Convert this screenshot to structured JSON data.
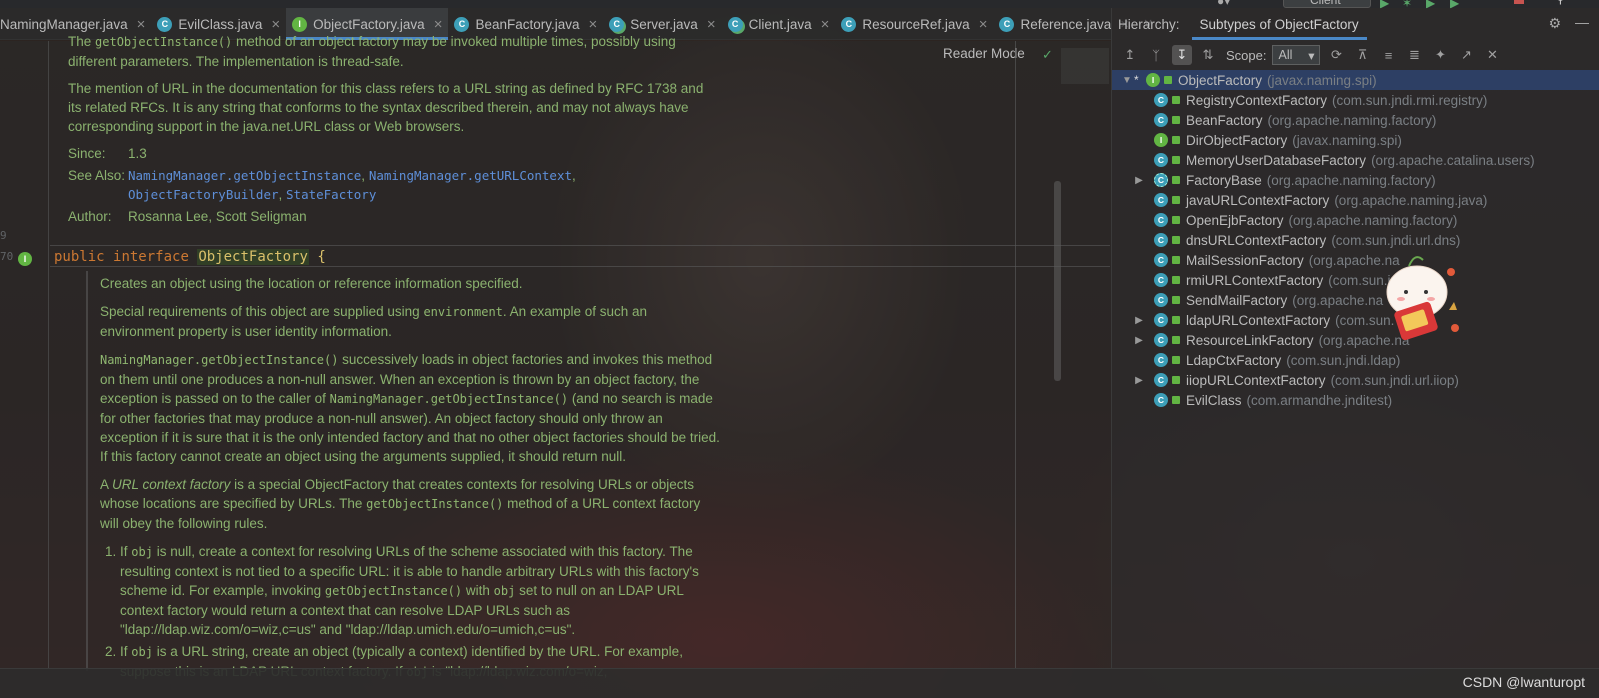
{
  "topbar": {
    "run_config": "Client"
  },
  "tabs": [
    {
      "label": "NamingManager.java",
      "icon": "class",
      "active": false
    },
    {
      "label": "EvilClass.java",
      "icon": "class",
      "active": false
    },
    {
      "label": "ObjectFactory.java",
      "icon": "interface",
      "active": true
    },
    {
      "label": "BeanFactory.java",
      "icon": "class",
      "active": false
    },
    {
      "label": "Server.java",
      "icon": "main-class",
      "active": false
    },
    {
      "label": "Client.java",
      "icon": "main-class",
      "active": false
    },
    {
      "label": "ResourceRef.java",
      "icon": "class",
      "active": false
    },
    {
      "label": "Reference.java",
      "icon": "class",
      "active": false
    }
  ],
  "editor": {
    "reader_mode": "Reader Mode",
    "gutter": [
      "9",
      "70"
    ],
    "doc_top": {
      "p1_pre": "The ",
      "p1_code": "getObjectInstance()",
      "p1_post": " method of an object factory may be invoked multiple times, possibly using different parameters. The implementation is thread-safe.",
      "p2": "The mention of URL in the documentation for this class refers to a URL string as defined by RFC 1738 and its related RFCs. It is any string that conforms to the syntax described therein, and may not always have corresponding support in the java.net.URL class or Web browsers.",
      "since_label": "Since:",
      "since_value": "1.3",
      "see_label": "See Also:",
      "see_links": [
        "NamingManager.getObjectInstance",
        "NamingManager.getURLContext",
        "ObjectFactoryBuilder",
        "StateFactory"
      ],
      "author_label": "Author:",
      "author_value": "Rosanna Lee, Scott Seligman"
    },
    "code": {
      "kw1": "public",
      "kw2": "interface",
      "name": "ObjectFactory",
      "brace": "{"
    },
    "doc_body": {
      "p1": "Creates an object using the location or reference information specified.",
      "p2_pre": "Special requirements of this object are supplied using ",
      "p2_code": "environment",
      "p2_post": ". An example of such an environment property is user identity information.",
      "p3_code1": "NamingManager.getObjectInstance()",
      "p3_a": " successively loads in object factories and invokes this method on them until one produces a non-null answer. When an exception is thrown by an object factory, the exception is passed on to the caller of ",
      "p3_code2": "NamingManager.getObjectInstance()",
      "p3_b": " (and no search is made for other factories that may produce a non-null answer). An object factory should only throw an exception if it is sure that it is the only intended factory and that no other object factories should be tried. If this factory cannot create an object using the arguments supplied, it should return null.",
      "p4_a": "A ",
      "p4_em": "URL context factory",
      "p4_b": " is a special ObjectFactory that creates contexts for resolving URLs or objects whose locations are specified by URLs. The ",
      "p4_code": "getObjectInstance()",
      "p4_c": " method of a URL context factory will obey the following rules.",
      "li1_a": "If ",
      "li1_code1": "obj",
      "li1_b": " is null, create a context for resolving URLs of the scheme associated with this factory. The resulting context is not tied to a specific URL: it is able to handle arbitrary URLs with this factory's scheme id. For example, invoking ",
      "li1_code2": "getObjectInstance()",
      "li1_c": " with ",
      "li1_code3": "obj",
      "li1_d": " set to null on an LDAP URL context factory would return a context that can resolve LDAP URLs such as \"ldap://ldap.wiz.com/o=wiz,c=us\" and \"ldap://ldap.umich.edu/o=umich,c=us\".",
      "li2_a": "If ",
      "li2_code1": "obj",
      "li2_b": " is a URL string, create an object (typically a context) identified by the URL. For example, suppose this is an LDAP URL context factory. If ",
      "li2_code2": "obj",
      "li2_c": " is \"ldap://ldap.wiz.com/o=wiz,"
    }
  },
  "hierarchy": {
    "title": "Hierarchy:",
    "subtitle": "Subtypes of ObjectFactory",
    "scope_label": "Scope:",
    "scope_value": "All",
    "root": {
      "name": "ObjectFactory",
      "pkg": "(javax.naming.spi)"
    },
    "items": [
      {
        "name": "RegistryContextFactory",
        "pkg": "(com.sun.jndi.rmi.registry)",
        "icon": "class",
        "expandable": false
      },
      {
        "name": "BeanFactory",
        "pkg": "(org.apache.naming.factory)",
        "icon": "class",
        "expandable": false
      },
      {
        "name": "DirObjectFactory",
        "pkg": "(javax.naming.spi)",
        "icon": "interface",
        "expandable": false
      },
      {
        "name": "MemoryUserDatabaseFactory",
        "pkg": "(org.apache.catalina.users)",
        "icon": "class",
        "expandable": false
      },
      {
        "name": "FactoryBase",
        "pkg": "(org.apache.naming.factory)",
        "icon": "abstract",
        "expandable": true
      },
      {
        "name": "javaURLContextFactory",
        "pkg": "(org.apache.naming.java)",
        "icon": "class",
        "expandable": false
      },
      {
        "name": "OpenEjbFactory",
        "pkg": "(org.apache.naming.factory)",
        "icon": "class",
        "expandable": false
      },
      {
        "name": "dnsURLContextFactory",
        "pkg": "(com.sun.jndi.url.dns)",
        "icon": "class",
        "expandable": false
      },
      {
        "name": "MailSessionFactory",
        "pkg": "(org.apache.na",
        "icon": "class",
        "expandable": false
      },
      {
        "name": "rmiURLContextFactory",
        "pkg": "(com.sun.j",
        "icon": "class",
        "expandable": false
      },
      {
        "name": "SendMailFactory",
        "pkg": "(org.apache.na",
        "icon": "class",
        "expandable": false
      },
      {
        "name": "ldapURLContextFactory",
        "pkg": "(com.sun.",
        "icon": "class",
        "expandable": true
      },
      {
        "name": "ResourceLinkFactory",
        "pkg": "(org.apache.na",
        "icon": "class",
        "expandable": true
      },
      {
        "name": "LdapCtxFactory",
        "pkg": "(com.sun.jndi.ldap)",
        "icon": "class",
        "expandable": false
      },
      {
        "name": "iiopURLContextFactory",
        "pkg": "(com.sun.jndi.url.iiop)",
        "icon": "class",
        "expandable": true
      },
      {
        "name": "EvilClass",
        "pkg": "(com.armandhe.jnditest)",
        "icon": "class",
        "expandable": false
      }
    ]
  },
  "statusbar": {
    "watermark": "CSDN @lwanturopt"
  },
  "colors": {
    "accent": "#4a88c7",
    "doc_text": "#8bb26f",
    "keyword": "#cc7832",
    "link": "#5e8fd8",
    "selection": "#2e436e"
  }
}
